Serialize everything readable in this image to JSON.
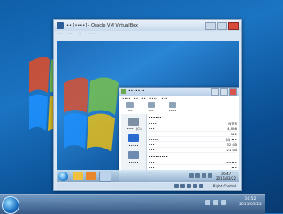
{
  "colors": {
    "desktop": "#1b74c2",
    "vbox_chrome": "#d8e6f4",
    "accent": "#2a6bd0",
    "close": "#d64b3a"
  },
  "vbox": {
    "title": "•• [••••] - Oracle VM VirtualBox",
    "menu": [
      "••",
      "••",
      "••",
      "••••"
    ],
    "host_key": "Right Control"
  },
  "file_system": {
    "title": "•••••••",
    "menu": [
      "••••",
      "••",
      "••",
      "••••",
      "•••"
    ],
    "toolbar": [
      "••",
      "••",
      "••••"
    ],
    "left_items": [
      {
        "label": "••••• (C:)",
        "icon": "drive-icon"
      },
      {
        "label": "•••••",
        "icon": "disk-icon",
        "selected": true
      },
      {
        "label": "•••••",
        "icon": "network-drive-icon"
      }
    ],
    "section1_title": "••••••",
    "section1_rows": [
      {
        "name": "••••",
        "value": "NTFS"
      },
      {
        "name": "•••",
        "value": "4,096"
      },
      {
        "name": "••••",
        "value": "512"
      },
      {
        "name": "•••••",
        "value": "64 •••"
      },
      {
        "name": "•••",
        "value": "32 GB"
      },
      {
        "name": "•••",
        "value": "21 GB"
      }
    ],
    "section2_title": "•••••••••",
    "section2_rows": [
      {
        "name": "•••",
        "value": "••••••"
      },
      {
        "name": "•••",
        "value": "•••"
      },
      {
        "name": "•••",
        "value": "••••"
      }
    ]
  },
  "guest_taskbar": {
    "time": "16:47",
    "date": "2011/03/22"
  },
  "host_taskbar": {
    "time": "16:52",
    "date": "2011/03/22"
  }
}
